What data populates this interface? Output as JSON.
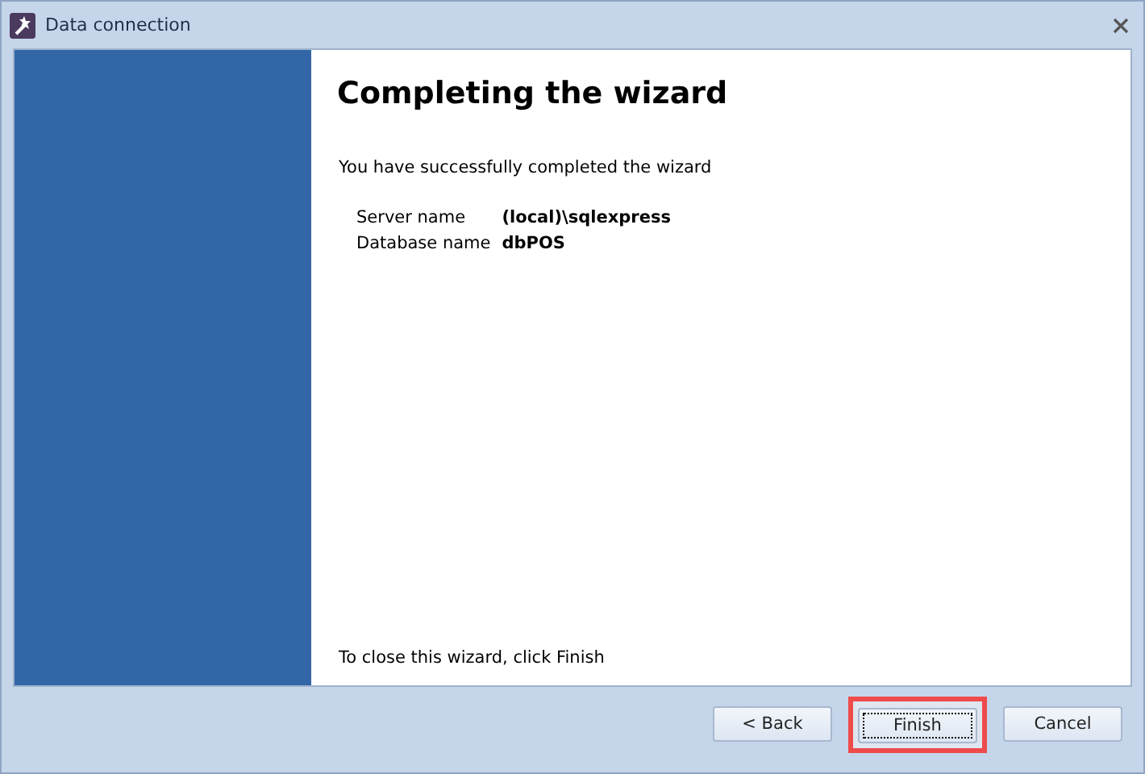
{
  "window": {
    "title": "Data connection"
  },
  "heading": "Completing the wizard",
  "message": "You have successfully completed the wizard",
  "details": [
    {
      "label": "Server name",
      "value": "(local)\\sqlexpress"
    },
    {
      "label": "Database name",
      "value": "dbPOS"
    }
  ],
  "footer_note": "To close this wizard, click Finish",
  "buttons": [
    {
      "label": "< Back",
      "focused": false,
      "highlighted": false
    },
    {
      "label": "Finish",
      "focused": true,
      "highlighted": true
    },
    {
      "label": "Cancel",
      "focused": false,
      "highlighted": false
    }
  ]
}
